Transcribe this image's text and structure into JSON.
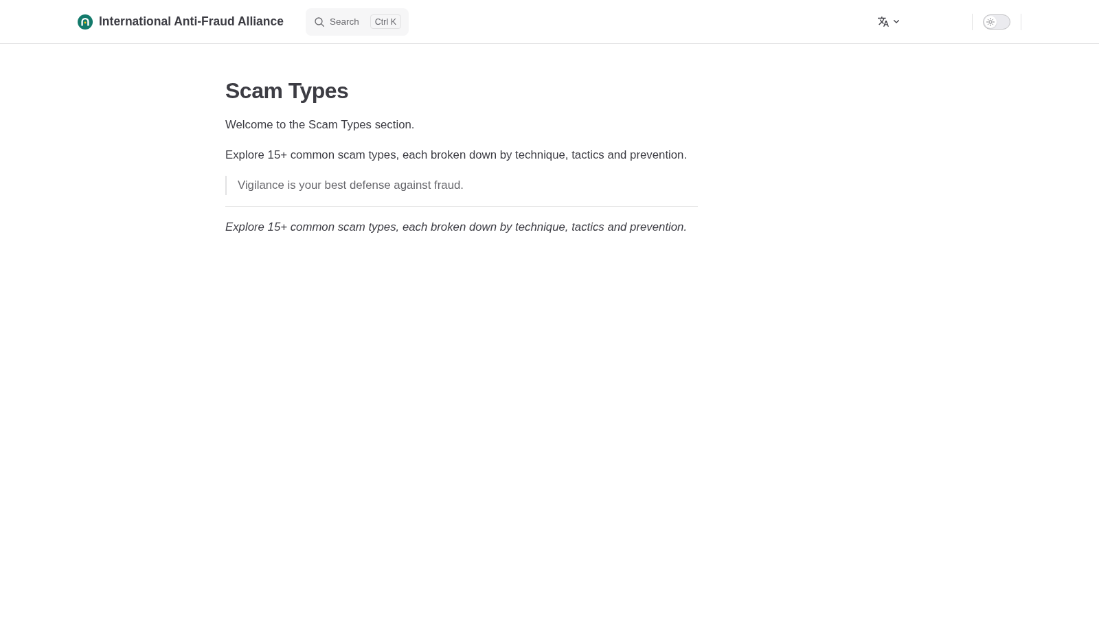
{
  "header": {
    "site_title": "International Anti-Fraud Alliance",
    "search": {
      "label": "Search",
      "shortcut": "Ctrl K"
    },
    "theme_switch": {
      "checked": false
    }
  },
  "page": {
    "title": "Scam Types",
    "blocks": [
      {
        "kind": "paragraph",
        "text": "Welcome to the Scam Types section."
      },
      {
        "kind": "paragraph",
        "text": "Explore 15+ common scam types, each broken down by technique, tactics and prevention."
      },
      {
        "kind": "quote",
        "text": "Vigilance is your best defense against fraud."
      },
      {
        "kind": "rule"
      },
      {
        "kind": "emphasis",
        "text": "Explore 15+ common scam types, each broken down by technique, tactics and prevention."
      }
    ]
  }
}
